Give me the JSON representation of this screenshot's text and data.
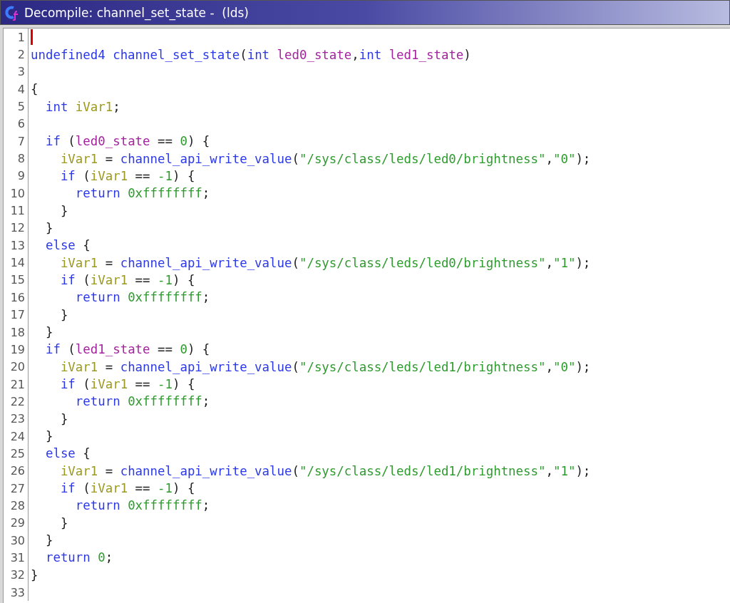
{
  "window": {
    "title": "Decompile: channel_set_state -  (lds)"
  },
  "lines": [
    {
      "number": "1",
      "cursor": true
    },
    {
      "number": "2",
      "cursor": false,
      "tokens": [
        {
          "kind": "keyword",
          "text": "undefined4 "
        },
        {
          "kind": "function",
          "text": "channel_set_state"
        },
        {
          "kind": "plain",
          "text": "("
        },
        {
          "kind": "keyword",
          "text": "int "
        },
        {
          "kind": "param",
          "text": "led0_state"
        },
        {
          "kind": "plain",
          "text": ","
        },
        {
          "kind": "keyword",
          "text": "int "
        },
        {
          "kind": "param",
          "text": "led1_state"
        },
        {
          "kind": "plain",
          "text": ")"
        }
      ]
    },
    {
      "number": "3",
      "cursor": false
    },
    {
      "number": "4",
      "cursor": false,
      "tokens": [
        {
          "kind": "plain",
          "text": "{"
        }
      ]
    },
    {
      "number": "5",
      "cursor": false,
      "tokens": [
        {
          "kind": "keyword",
          "text": "  int "
        },
        {
          "kind": "local",
          "text": "iVar1"
        },
        {
          "kind": "plain",
          "text": ";"
        }
      ]
    },
    {
      "number": "6",
      "cursor": false
    },
    {
      "number": "7",
      "cursor": false,
      "tokens": [
        {
          "kind": "keyword",
          "text": "  if"
        },
        {
          "kind": "plain",
          "text": " ("
        },
        {
          "kind": "param",
          "text": "led0_state"
        },
        {
          "kind": "plain",
          "text": " == "
        },
        {
          "kind": "constant",
          "text": "0"
        },
        {
          "kind": "plain",
          "text": ") {"
        }
      ]
    },
    {
      "number": "8",
      "cursor": false,
      "tokens": [
        {
          "kind": "local",
          "text": "    iVar1"
        },
        {
          "kind": "plain",
          "text": " = "
        },
        {
          "kind": "function",
          "text": "channel_api_write_value"
        },
        {
          "kind": "plain",
          "text": "("
        },
        {
          "kind": "constant",
          "text": "\"/sys/class/leds/led0/brightness\""
        },
        {
          "kind": "plain",
          "text": ","
        },
        {
          "kind": "constant",
          "text": "\"0\""
        },
        {
          "kind": "plain",
          "text": ");"
        }
      ]
    },
    {
      "number": "9",
      "cursor": false,
      "tokens": [
        {
          "kind": "keyword",
          "text": "    if"
        },
        {
          "kind": "plain",
          "text": " ("
        },
        {
          "kind": "local",
          "text": "iVar1"
        },
        {
          "kind": "plain",
          "text": " == "
        },
        {
          "kind": "constant",
          "text": "-1"
        },
        {
          "kind": "plain",
          "text": ") {"
        }
      ]
    },
    {
      "number": "10",
      "cursor": false,
      "tokens": [
        {
          "kind": "keyword",
          "text": "      return "
        },
        {
          "kind": "constant",
          "text": "0xffffffff"
        },
        {
          "kind": "plain",
          "text": ";"
        }
      ]
    },
    {
      "number": "11",
      "cursor": false,
      "tokens": [
        {
          "kind": "plain",
          "text": "    }"
        }
      ]
    },
    {
      "number": "12",
      "cursor": false,
      "tokens": [
        {
          "kind": "plain",
          "text": "  }"
        }
      ]
    },
    {
      "number": "13",
      "cursor": false,
      "tokens": [
        {
          "kind": "keyword",
          "text": "  else"
        },
        {
          "kind": "plain",
          "text": " {"
        }
      ]
    },
    {
      "number": "14",
      "cursor": false,
      "tokens": [
        {
          "kind": "local",
          "text": "    iVar1"
        },
        {
          "kind": "plain",
          "text": " = "
        },
        {
          "kind": "function",
          "text": "channel_api_write_value"
        },
        {
          "kind": "plain",
          "text": "("
        },
        {
          "kind": "constant",
          "text": "\"/sys/class/leds/led0/brightness\""
        },
        {
          "kind": "plain",
          "text": ","
        },
        {
          "kind": "constant",
          "text": "\"1\""
        },
        {
          "kind": "plain",
          "text": ");"
        }
      ]
    },
    {
      "number": "15",
      "cursor": false,
      "tokens": [
        {
          "kind": "keyword",
          "text": "    if"
        },
        {
          "kind": "plain",
          "text": " ("
        },
        {
          "kind": "local",
          "text": "iVar1"
        },
        {
          "kind": "plain",
          "text": " == "
        },
        {
          "kind": "constant",
          "text": "-1"
        },
        {
          "kind": "plain",
          "text": ") {"
        }
      ]
    },
    {
      "number": "16",
      "cursor": false,
      "tokens": [
        {
          "kind": "keyword",
          "text": "      return "
        },
        {
          "kind": "constant",
          "text": "0xffffffff"
        },
        {
          "kind": "plain",
          "text": ";"
        }
      ]
    },
    {
      "number": "17",
      "cursor": false,
      "tokens": [
        {
          "kind": "plain",
          "text": "    }"
        }
      ]
    },
    {
      "number": "18",
      "cursor": false,
      "tokens": [
        {
          "kind": "plain",
          "text": "  }"
        }
      ]
    },
    {
      "number": "19",
      "cursor": false,
      "tokens": [
        {
          "kind": "keyword",
          "text": "  if"
        },
        {
          "kind": "plain",
          "text": " ("
        },
        {
          "kind": "param",
          "text": "led1_state"
        },
        {
          "kind": "plain",
          "text": " == "
        },
        {
          "kind": "constant",
          "text": "0"
        },
        {
          "kind": "plain",
          "text": ") {"
        }
      ]
    },
    {
      "number": "20",
      "cursor": false,
      "tokens": [
        {
          "kind": "local",
          "text": "    iVar1"
        },
        {
          "kind": "plain",
          "text": " = "
        },
        {
          "kind": "function",
          "text": "channel_api_write_value"
        },
        {
          "kind": "plain",
          "text": "("
        },
        {
          "kind": "constant",
          "text": "\"/sys/class/leds/led1/brightness\""
        },
        {
          "kind": "plain",
          "text": ","
        },
        {
          "kind": "constant",
          "text": "\"0\""
        },
        {
          "kind": "plain",
          "text": ");"
        }
      ]
    },
    {
      "number": "21",
      "cursor": false,
      "tokens": [
        {
          "kind": "keyword",
          "text": "    if"
        },
        {
          "kind": "plain",
          "text": " ("
        },
        {
          "kind": "local",
          "text": "iVar1"
        },
        {
          "kind": "plain",
          "text": " == "
        },
        {
          "kind": "constant",
          "text": "-1"
        },
        {
          "kind": "plain",
          "text": ") {"
        }
      ]
    },
    {
      "number": "22",
      "cursor": false,
      "tokens": [
        {
          "kind": "keyword",
          "text": "      return "
        },
        {
          "kind": "constant",
          "text": "0xffffffff"
        },
        {
          "kind": "plain",
          "text": ";"
        }
      ]
    },
    {
      "number": "23",
      "cursor": false,
      "tokens": [
        {
          "kind": "plain",
          "text": "    }"
        }
      ]
    },
    {
      "number": "24",
      "cursor": false,
      "tokens": [
        {
          "kind": "plain",
          "text": "  }"
        }
      ]
    },
    {
      "number": "25",
      "cursor": false,
      "tokens": [
        {
          "kind": "keyword",
          "text": "  else"
        },
        {
          "kind": "plain",
          "text": " {"
        }
      ]
    },
    {
      "number": "26",
      "cursor": false,
      "tokens": [
        {
          "kind": "local",
          "text": "    iVar1"
        },
        {
          "kind": "plain",
          "text": " = "
        },
        {
          "kind": "function",
          "text": "channel_api_write_value"
        },
        {
          "kind": "plain",
          "text": "("
        },
        {
          "kind": "constant",
          "text": "\"/sys/class/leds/led1/brightness\""
        },
        {
          "kind": "plain",
          "text": ","
        },
        {
          "kind": "constant",
          "text": "\"1\""
        },
        {
          "kind": "plain",
          "text": ");"
        }
      ]
    },
    {
      "number": "27",
      "cursor": false,
      "tokens": [
        {
          "kind": "keyword",
          "text": "    if"
        },
        {
          "kind": "plain",
          "text": " ("
        },
        {
          "kind": "local",
          "text": "iVar1"
        },
        {
          "kind": "plain",
          "text": " == "
        },
        {
          "kind": "constant",
          "text": "-1"
        },
        {
          "kind": "plain",
          "text": ") {"
        }
      ]
    },
    {
      "number": "28",
      "cursor": false,
      "tokens": [
        {
          "kind": "keyword",
          "text": "      return "
        },
        {
          "kind": "constant",
          "text": "0xffffffff"
        },
        {
          "kind": "plain",
          "text": ";"
        }
      ]
    },
    {
      "number": "29",
      "cursor": false,
      "tokens": [
        {
          "kind": "plain",
          "text": "    }"
        }
      ]
    },
    {
      "number": "30",
      "cursor": false,
      "tokens": [
        {
          "kind": "plain",
          "text": "  }"
        }
      ]
    },
    {
      "number": "31",
      "cursor": false,
      "tokens": [
        {
          "kind": "keyword",
          "text": "  return "
        },
        {
          "kind": "constant",
          "text": "0"
        },
        {
          "kind": "plain",
          "text": ";"
        }
      ]
    },
    {
      "number": "32",
      "cursor": false,
      "tokens": [
        {
          "kind": "plain",
          "text": "}"
        }
      ]
    },
    {
      "number": "33",
      "cursor": false
    }
  ]
}
